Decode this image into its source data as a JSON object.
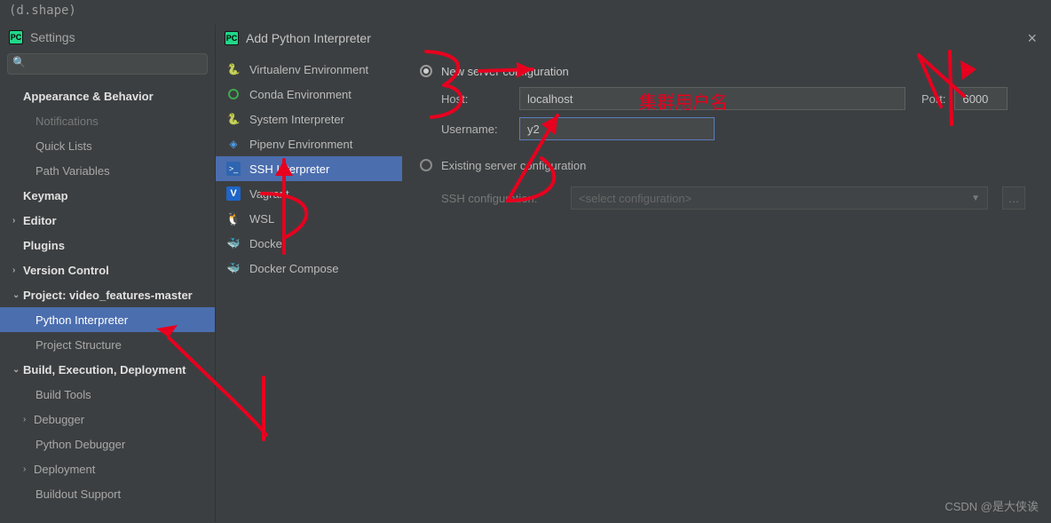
{
  "top_bar_text": "(d.shape)",
  "settings_title": "Settings",
  "search_placeholder": "",
  "tree": {
    "appearance": "Appearance & Behavior",
    "notifications": "Notifications",
    "quick_lists": "Quick Lists",
    "path_variables": "Path Variables",
    "keymap": "Keymap",
    "editor": "Editor",
    "plugins": "Plugins",
    "vcs": "Version Control",
    "project": "Project: video_features-master",
    "py_interp": "Python Interpreter",
    "proj_struct": "Project Structure",
    "build": "Build, Execution, Deployment",
    "build_tools": "Build Tools",
    "debugger": "Debugger",
    "py_dbg": "Python Debugger",
    "deployment": "Deployment",
    "buildout": "Buildout Support"
  },
  "dialog_title": "Add Python Interpreter",
  "interp_list": {
    "venv": "Virtualenv Environment",
    "conda": "Conda Environment",
    "sys": "System Interpreter",
    "pipenv": "Pipenv Environment",
    "ssh": "SSH Interpreter",
    "vagrant": "Vagrant",
    "wsl": "WSL",
    "docker": "Docker",
    "compose": "Docker Compose"
  },
  "form": {
    "new_server": "New server configuration",
    "host_lbl": "Host:",
    "host_val": "localhost",
    "port_lbl": "Port:",
    "port_val": "6000",
    "user_lbl": "Username:",
    "user_val": "y2",
    "existing": "Existing server configuration",
    "ssh_cfg_lbl": "SSH configuration:",
    "ssh_cfg_val": "<select configuration>"
  },
  "annotations": {
    "username_note": "集群用户名"
  },
  "watermark": "CSDN @是大侠诶"
}
